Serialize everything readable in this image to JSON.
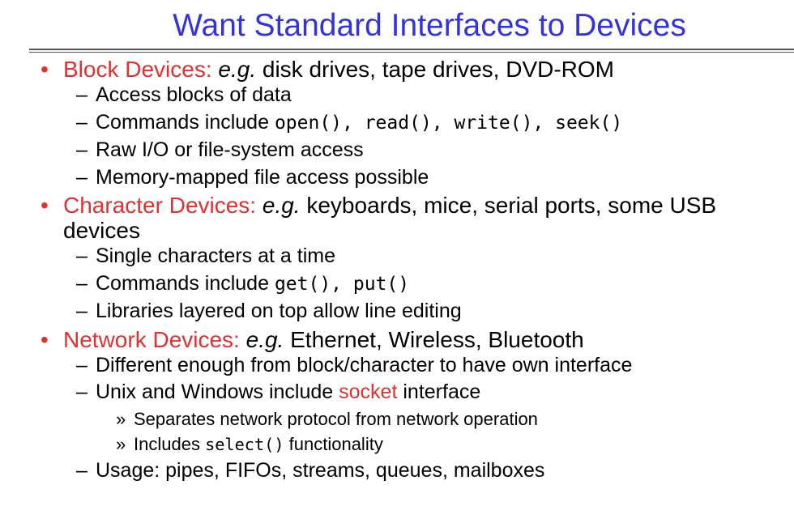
{
  "slide": {
    "title": "Want Standard Interfaces to Devices",
    "sections": [
      {
        "head": "Block Devices:",
        "eg": "e.g.",
        "desc": " disk drives, tape drives, DVD-ROM",
        "items": {
          "i0": "Access blocks of data",
          "i1_pre": "Commands include ",
          "i1_code": "open(), read(), write(), seek()",
          "i2": "Raw I/O or file-system access",
          "i3": "Memory-mapped file access possible"
        }
      },
      {
        "head": "Character Devices:",
        "eg": "e.g.",
        "desc": " keyboards, mice, serial ports, some USB devices",
        "items": {
          "i0": "Single characters at a time",
          "i1_pre": "Commands include ",
          "i1_code": "get(), put()",
          "i2": "Libraries layered on top allow line editing"
        }
      },
      {
        "head": "Network Devices:",
        "eg": "e.g.",
        "desc": " Ethernet, Wireless, Bluetooth",
        "items": {
          "i0": "Different enough from block/character to have own interface",
          "i1_pre": "Unix and Windows include ",
          "i1_red": "socket",
          "i1_post": " interface",
          "sub0": "Separates network protocol from network operation",
          "sub1_pre": "Includes ",
          "sub1_code": "select()",
          "sub1_post": " functionality",
          "i2": "Usage: pipes, FIFOs, streams, queues, mailboxes"
        }
      }
    ]
  },
  "glyphs": {
    "bullet": "•",
    "dash": "–",
    "sub": "»"
  },
  "colors": {
    "title": "#3333dd",
    "accent": "#e03030"
  }
}
